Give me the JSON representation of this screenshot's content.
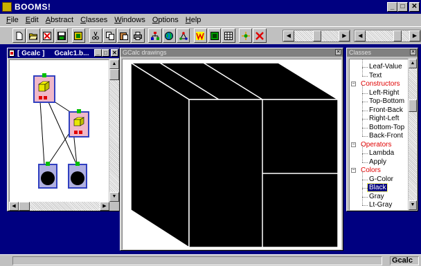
{
  "app": {
    "title": "BOOMS!"
  },
  "menu": [
    {
      "id": "file",
      "label": "File",
      "mnemonic": "F",
      "rest": "ile"
    },
    {
      "id": "edit",
      "label": "Edit",
      "mnemonic": "E",
      "rest": "dit"
    },
    {
      "id": "abstract",
      "label": "Abstract",
      "mnemonic": "A",
      "rest": "bstract"
    },
    {
      "id": "classes",
      "label": "Classes",
      "mnemonic": "C",
      "rest": "lasses"
    },
    {
      "id": "windows",
      "label": "Windows",
      "mnemonic": "W",
      "rest": "indows"
    },
    {
      "id": "options",
      "label": "Options",
      "mnemonic": "O",
      "rest": "ptions"
    },
    {
      "id": "help",
      "label": "Help",
      "mnemonic": "H",
      "rest": "elp"
    }
  ],
  "toolbar": {
    "buttons": [
      {
        "id": "new",
        "icon": "new-document-icon"
      },
      {
        "id": "open",
        "icon": "open-folder-icon"
      },
      {
        "id": "close",
        "icon": "close-document-icon"
      },
      {
        "id": "save",
        "icon": "save-icon"
      },
      {
        "id": "properties",
        "icon": "properties-icon"
      },
      {
        "id": "cut",
        "icon": "scissors-icon"
      },
      {
        "id": "copy",
        "icon": "copy-icon"
      },
      {
        "id": "paste",
        "icon": "paste-icon"
      },
      {
        "id": "print",
        "icon": "print-icon"
      },
      {
        "id": "tool1",
        "icon": "tree-icon"
      },
      {
        "id": "tool2",
        "icon": "globe-icon"
      },
      {
        "id": "tool3",
        "icon": "network-icon"
      },
      {
        "id": "tool4",
        "icon": "w-icon"
      },
      {
        "id": "tool5",
        "icon": "green-box-icon"
      },
      {
        "id": "tool6",
        "icon": "grid-icon"
      },
      {
        "id": "tool7",
        "icon": "node-link-icon"
      },
      {
        "id": "tool8",
        "icon": "red-x-icon"
      }
    ],
    "slider1_position": 0.52,
    "slider2_position": 0.78
  },
  "gcalc_window": {
    "title_part1": "[ Gcalc ]",
    "title_part2": "Gcalc1.b..."
  },
  "drawing_window": {
    "title": "GCalc drawings"
  },
  "classes_window": {
    "title": "Classes",
    "items": [
      {
        "label": "Leaf-Value",
        "type": "leaf",
        "level": 1
      },
      {
        "label": "Text",
        "type": "leaf",
        "level": 1
      },
      {
        "label": "Constructors",
        "type": "category",
        "level": 0
      },
      {
        "label": "Left-Right",
        "type": "leaf",
        "level": 1
      },
      {
        "label": "Top-Bottom",
        "type": "leaf",
        "level": 1
      },
      {
        "label": "Front-Back",
        "type": "leaf",
        "level": 1
      },
      {
        "label": "Right-Left",
        "type": "leaf",
        "level": 1
      },
      {
        "label": "Bottom-Top",
        "type": "leaf",
        "level": 1
      },
      {
        "label": "Back-Front",
        "type": "leaf",
        "level": 1
      },
      {
        "label": "Operators",
        "type": "category",
        "level": 0
      },
      {
        "label": "Lambda",
        "type": "leaf",
        "level": 1
      },
      {
        "label": "Apply",
        "type": "leaf",
        "level": 1
      },
      {
        "label": "Colors",
        "type": "category",
        "level": 0
      },
      {
        "label": "G-Color",
        "type": "leaf",
        "level": 1
      },
      {
        "label": "Black",
        "type": "leaf",
        "level": 1,
        "selected": true
      },
      {
        "label": "Gray",
        "type": "leaf",
        "level": 1
      },
      {
        "label": "Lt-Gray",
        "type": "leaf",
        "level": 1
      }
    ]
  },
  "status": {
    "left": "",
    "right": "Gcalc"
  },
  "colors": {
    "titlebar": "#000080",
    "mdi_background": "#000080",
    "category_text": "#e00000",
    "node_fill": "#f0b8c8",
    "node_border": "#3040c0"
  }
}
